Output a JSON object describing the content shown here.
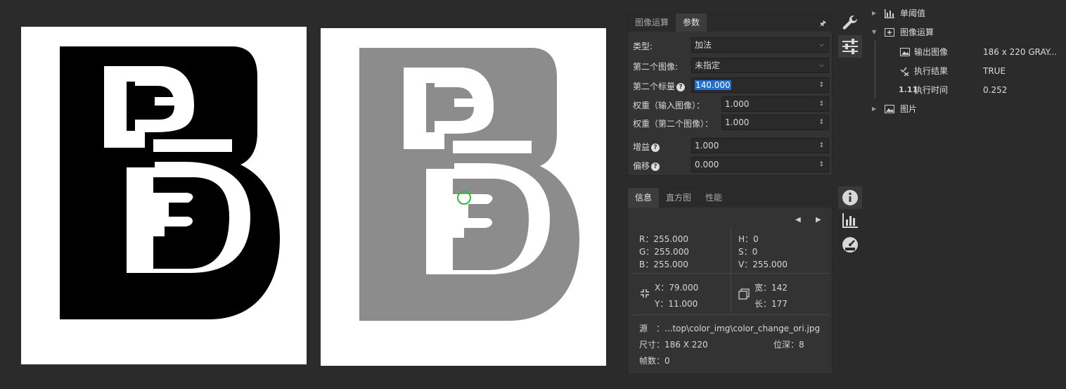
{
  "canvas": {
    "left_image": {
      "name": "input-image"
    },
    "right_image": {
      "name": "output-image"
    }
  },
  "param_panel": {
    "tabs": [
      "图像运算",
      "参数"
    ],
    "active_tab": "参数",
    "pin_icon": "pin-icon",
    "fields": {
      "type": {
        "label": "类型:",
        "value": "加法"
      },
      "second_image": {
        "label": "第二个图像:",
        "value": "未指定"
      },
      "second_scalar": {
        "label": "第二个标量",
        "value": "140.000"
      },
      "weight_input": {
        "label": "权重（输入图像）：",
        "value": "1.000"
      },
      "weight_second": {
        "label": "权重（第二个图像）：",
        "value": "1.000"
      },
      "gain": {
        "label": "增益",
        "value": "1.000"
      },
      "offset": {
        "label": "偏移",
        "value": "0.000"
      }
    }
  },
  "info_panel": {
    "tabs": [
      "信息",
      "直方图",
      "性能"
    ],
    "active_tab": "信息",
    "rgb": {
      "r": "R：255.000",
      "g": "G：255.000",
      "b": "B：255.000"
    },
    "hsv": {
      "h": "H：0",
      "s": "S：0",
      "v": "V：255.000"
    },
    "pos": {
      "x": "X：79.000",
      "y": "Y：11.000"
    },
    "size": {
      "w": "宽：142",
      "h": "长：177"
    },
    "source": "源　：...top\\color_img\\color_change_ori.jpg",
    "dims": "尺寸：186 X 220",
    "depth": "位深：8",
    "frames": "帧数：0"
  },
  "sidebar": {
    "buttons": [
      "wrench-icon",
      "sliders-icon",
      "info-icon",
      "histogram-icon",
      "gauge-icon"
    ]
  },
  "tree": {
    "nodes": [
      {
        "label": "单阈值",
        "value": ""
      },
      {
        "label": "图像运算",
        "value": ""
      },
      {
        "label": "输出图像",
        "value": "186 x 220 GRAY..."
      },
      {
        "label": "执行结果",
        "value": "TRUE"
      },
      {
        "label": "执行时间",
        "value": "0.252"
      },
      {
        "label": "图片",
        "value": ""
      }
    ],
    "time_badge": "1.11"
  }
}
